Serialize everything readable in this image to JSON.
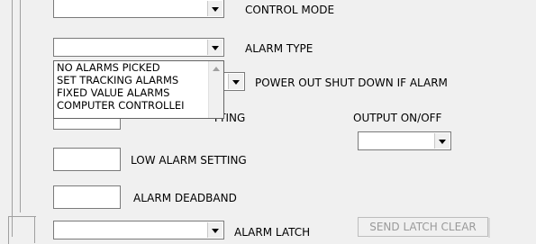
{
  "fields": {
    "control_mode": {
      "label": "CONTROL MODE",
      "value": ""
    },
    "alarm_type": {
      "label": "ALARM TYPE",
      "value": "",
      "options": [
        "NO ALARMS PICKED",
        "SET TRACKING ALARMS",
        "FIXED VALUE ALARMS",
        "COMPUTER CONTROLLEI"
      ]
    },
    "power_out_shutdown": {
      "label": "POWER OUT SHUT DOWN IF ALARM"
    },
    "high_alarm_setting": {
      "label_visible": "TTING",
      "value": ""
    },
    "output_on_off": {
      "label": "OUTPUT ON/OFF",
      "value": ""
    },
    "low_alarm_setting": {
      "label": "LOW ALARM SETTING",
      "value": ""
    },
    "alarm_deadband": {
      "label": "ALARM DEADBAND",
      "value": ""
    },
    "alarm_latch": {
      "label": "ALARM LATCH",
      "value": ""
    },
    "send_latch_clear": {
      "label": "SEND LATCH CLEAR",
      "enabled": false
    }
  }
}
